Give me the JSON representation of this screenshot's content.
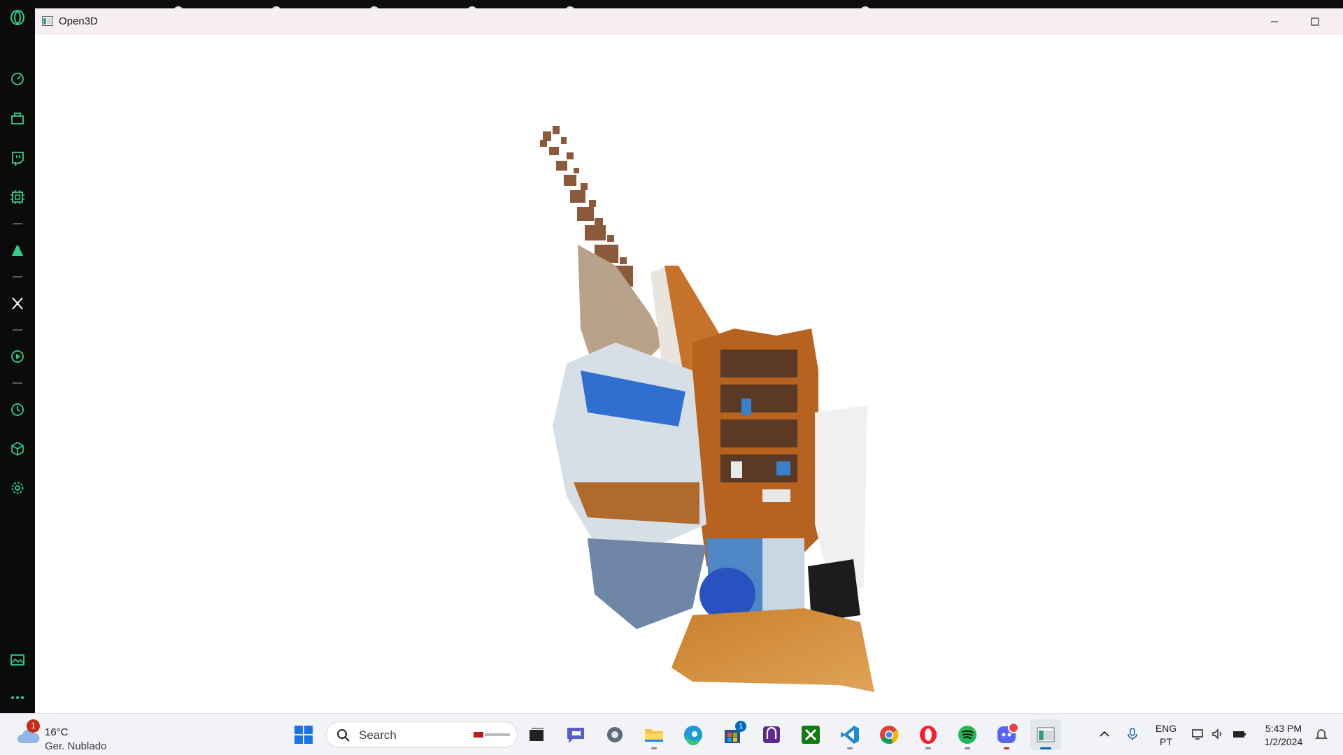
{
  "window": {
    "title": "Open3D"
  },
  "sidebar": {
    "items": [
      {
        "icon": "speed-dial-icon"
      },
      {
        "icon": "shopping-icon"
      },
      {
        "icon": "twitch-icon"
      },
      {
        "icon": "cpu-icon"
      },
      {
        "icon": "aria-icon"
      },
      {
        "icon": "x-twitter-icon"
      },
      {
        "icon": "player-icon"
      },
      {
        "icon": "history-icon"
      },
      {
        "icon": "extensions-cube-icon"
      },
      {
        "icon": "settings-gear-icon"
      },
      {
        "icon": "gallery-icon"
      },
      {
        "icon": "more-dots-icon"
      }
    ]
  },
  "taskbar": {
    "weather": {
      "temperature": "16°C",
      "condition": "Ger. Nublado",
      "badge": "1"
    },
    "search": {
      "placeholder": "Search"
    },
    "apps": [
      {
        "name": "start",
        "icon": "windows-start-icon"
      },
      {
        "name": "task-view",
        "icon": "task-view-icon"
      },
      {
        "name": "teams-chat",
        "icon": "chat-icon"
      },
      {
        "name": "settings",
        "icon": "settings-icon"
      },
      {
        "name": "file-explorer",
        "icon": "folder-icon"
      },
      {
        "name": "edge",
        "icon": "edge-icon"
      },
      {
        "name": "microsoft-store",
        "icon": "store-icon",
        "badge": "1"
      },
      {
        "name": "photo-app",
        "icon": "photo-app-icon"
      },
      {
        "name": "xbox",
        "icon": "xbox-icon"
      },
      {
        "name": "vscode",
        "icon": "vscode-icon"
      },
      {
        "name": "chrome",
        "icon": "chrome-icon"
      },
      {
        "name": "opera",
        "icon": "opera-icon"
      },
      {
        "name": "spotify",
        "icon": "spotify-icon"
      },
      {
        "name": "discord",
        "icon": "discord-icon"
      },
      {
        "name": "open3d",
        "icon": "open3d-icon"
      }
    ],
    "language": {
      "line1": "ENG",
      "line2": "PT"
    },
    "clock": {
      "time": "5:43 PM",
      "date": "1/2/2024"
    }
  },
  "colors": {
    "sidebar_icon": "#31d08a",
    "taskbar_bg": "#f1f3f6",
    "accent": "#0067c0"
  }
}
